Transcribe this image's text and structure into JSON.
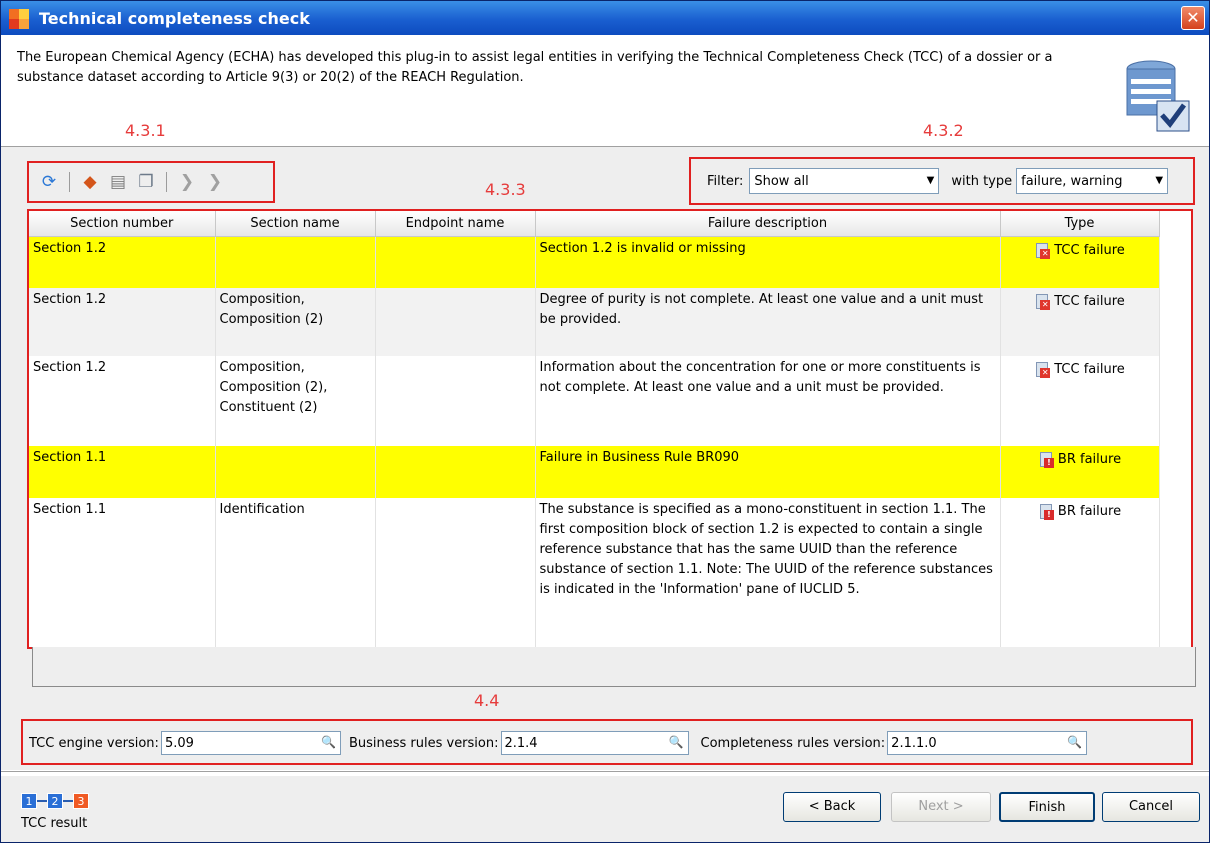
{
  "window": {
    "title": "Technical completeness check",
    "close": "✕"
  },
  "intro": {
    "text": "The European Chemical Agency (ECHA) has developed this plug-in to assist legal entities in verifying the Technical Completeness Check (TCC) of a dossier or a substance dataset according to Article 9(3) or 20(2) of the REACH Regulation."
  },
  "annotations": {
    "toolbar": "4.3.1",
    "filter": "4.3.2",
    "table": "4.3.3",
    "versions": "4.4"
  },
  "toolbar": {
    "icons": [
      "refresh-icon",
      "export-icon",
      "print-icon",
      "copy-icon",
      "previous-icon",
      "next-icon"
    ]
  },
  "filter": {
    "label": "Filter:",
    "value": "Show all",
    "type_label": "with type",
    "type_value": "failure, warning"
  },
  "table": {
    "columns": [
      "Section number",
      "Section name",
      "Endpoint name",
      "Failure description",
      "Type"
    ],
    "rows": [
      {
        "section": "Section 1.2",
        "name": "",
        "endpoint": "",
        "description": "Section 1.2 is invalid or missing",
        "type": "TCC failure"
      },
      {
        "section": "Section 1.2",
        "name": "Composition, Composition (2)",
        "endpoint": "",
        "description": "Degree of purity is not complete. At least one value and a unit must be provided.",
        "type": "TCC failure"
      },
      {
        "section": "Section 1.2",
        "name": "Composition, Composition (2), Constituent (2)",
        "endpoint": "",
        "description": "Information about the concentration for one or more constituents is not complete. At least one value and a unit must be provided.",
        "type": "TCC failure"
      },
      {
        "section": "Section 1.1",
        "name": "",
        "endpoint": "",
        "description": "Failure in Business Rule BR090",
        "type": "BR failure"
      },
      {
        "section": "Section 1.1",
        "name": "Identification",
        "endpoint": "",
        "description": "The substance is specified as a mono-constituent in section 1.1. The first composition block of section 1.2 is expected to contain a single reference substance that has the same UUID than the reference substance of section 1.1. Note: The UUID of the reference substances is indicated in the 'Information' pane of IUCLID 5.",
        "type": "BR failure"
      }
    ]
  },
  "versions": {
    "tcc_label": "TCC engine version:",
    "tcc_value": "5.09",
    "br_label": "Business rules version:",
    "br_value": "2.1.4",
    "cr_label": "Completeness rules version:",
    "cr_value": "2.1.1.0"
  },
  "wizard": {
    "steps": [
      "1",
      "2",
      "3"
    ],
    "current_label": "TCC result",
    "back": "< Back",
    "next": "Next >",
    "finish": "Finish",
    "cancel": "Cancel"
  },
  "colors": {
    "highlight": "#ffff00",
    "annotation": "#e02020",
    "title_bar": "#1a5fd0"
  }
}
